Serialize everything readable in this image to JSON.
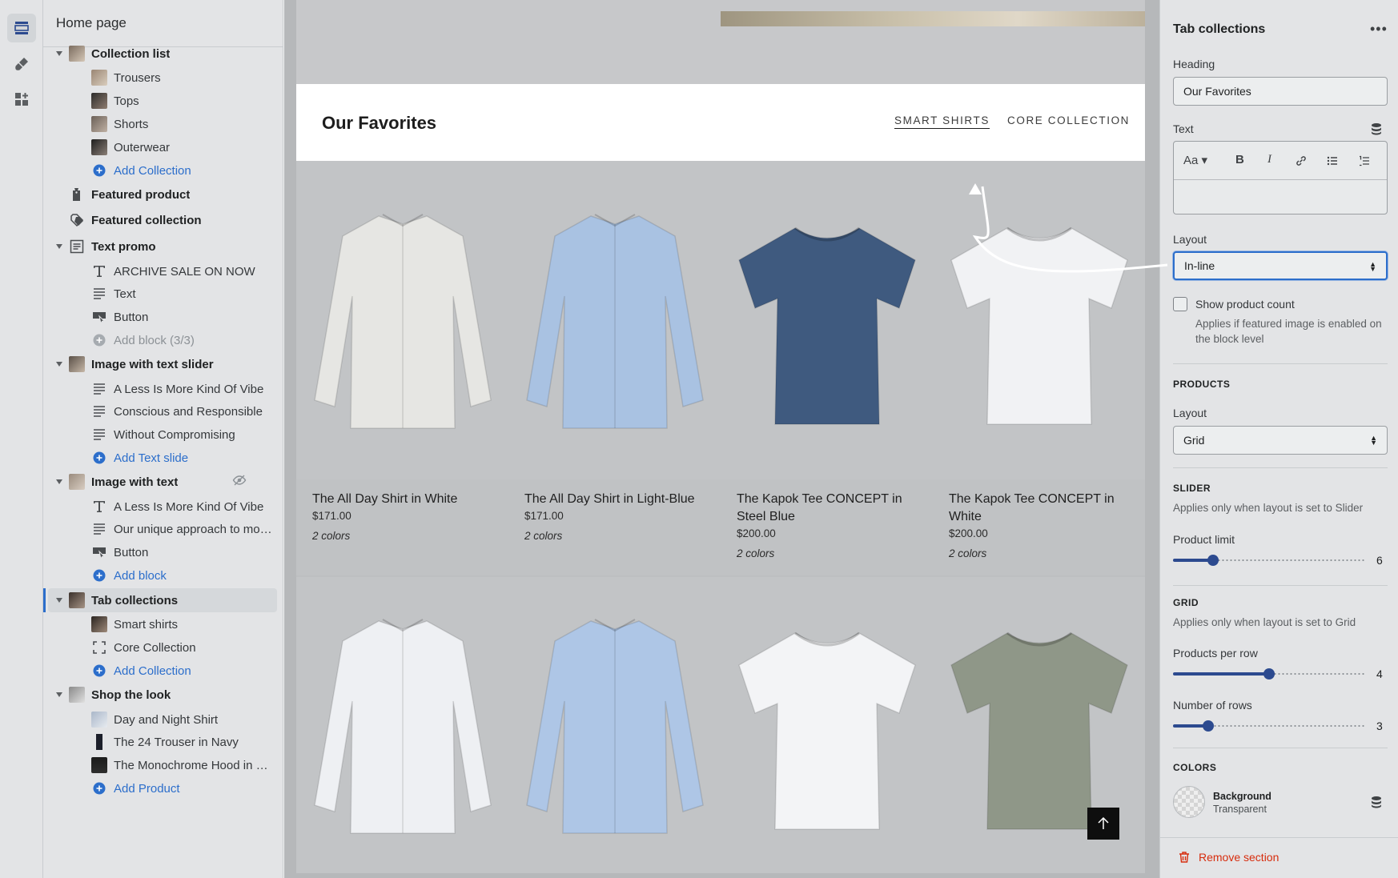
{
  "sidebar": {
    "title": "Home page",
    "rows": [
      {
        "type": "sec",
        "label": "Collection list",
        "caret": true,
        "thumb": "collection"
      },
      {
        "type": "child",
        "label": "Trousers",
        "thumb": "trousers"
      },
      {
        "type": "child",
        "label": "Tops",
        "thumb": "tops"
      },
      {
        "type": "child",
        "label": "Shorts",
        "thumb": "shorts"
      },
      {
        "type": "child",
        "label": "Outerwear",
        "thumb": "outerwear"
      },
      {
        "type": "child add",
        "label": "Add Collection",
        "icon": "plus-circle-icon"
      },
      {
        "type": "sec",
        "label": "Featured product",
        "icon": "product-tag-icon"
      },
      {
        "type": "sec",
        "label": "Featured collection",
        "icon": "collection-tag-icon"
      },
      {
        "type": "sec",
        "label": "Text promo",
        "caret": true,
        "icon": "text-block-icon"
      },
      {
        "type": "child",
        "label": "ARCHIVE SALE ON NOW",
        "icon": "heading-icon"
      },
      {
        "type": "child",
        "label": "Text",
        "icon": "paragraph-icon"
      },
      {
        "type": "child",
        "label": "Button",
        "icon": "button-icon"
      },
      {
        "type": "child disabled",
        "label": "Add block (3/3)",
        "icon": "plus-circle-disabled-icon"
      },
      {
        "type": "sec",
        "label": "Image with text slider",
        "caret": true,
        "thumb": "slider"
      },
      {
        "type": "child",
        "label": "A Less Is More Kind Of Vibe",
        "icon": "paragraph-icon"
      },
      {
        "type": "child",
        "label": "Conscious and Responsible",
        "icon": "paragraph-icon"
      },
      {
        "type": "child",
        "label": "Without Compromising",
        "icon": "paragraph-icon"
      },
      {
        "type": "child add",
        "label": "Add Text slide",
        "icon": "plus-circle-icon"
      },
      {
        "type": "sec",
        "label": "Image with text",
        "caret": true,
        "thumb": "imgtext",
        "hidden": true
      },
      {
        "type": "child",
        "label": "A Less Is More Kind Of Vibe",
        "icon": "heading-icon"
      },
      {
        "type": "child",
        "label": "Our unique approach to mod...",
        "icon": "paragraph-icon"
      },
      {
        "type": "child",
        "label": "Button",
        "icon": "button-icon"
      },
      {
        "type": "child add",
        "label": "Add block",
        "icon": "plus-circle-icon"
      },
      {
        "type": "sec selected",
        "label": "Tab collections",
        "caret": true,
        "thumb": "tabs"
      },
      {
        "type": "child",
        "label": "Smart shirts",
        "thumb": "smart"
      },
      {
        "type": "child",
        "label": "Core Collection",
        "icon": "dashed-frame-icon"
      },
      {
        "type": "child add",
        "label": "Add Collection",
        "icon": "plus-circle-icon"
      },
      {
        "type": "sec",
        "label": "Shop the look",
        "caret": true,
        "thumb": "look"
      },
      {
        "type": "child",
        "label": "Day and Night Shirt",
        "thumb": "shirt"
      },
      {
        "type": "child",
        "label": "The 24 Trouser in Navy",
        "thumb": "trouser"
      },
      {
        "type": "child",
        "label": "The Monochrome Hood in Na...",
        "thumb": "hood"
      },
      {
        "type": "child add",
        "label": "Add Product",
        "icon": "plus-circle-icon"
      }
    ]
  },
  "preview": {
    "heading": "Our Favorites",
    "tabs": [
      {
        "label": "SMART SHIRTS",
        "active": true
      },
      {
        "label": "CORE COLLECTION",
        "active": false
      }
    ],
    "products": [
      {
        "name": "The All Day Shirt in White",
        "price": "$171.00",
        "colors": "2 colors",
        "kind": "shirt",
        "color": "#e6e6e3"
      },
      {
        "name": "The All Day Shirt in Light-Blue",
        "price": "$171.00",
        "colors": "2 colors",
        "kind": "shirt",
        "color": "#a9c2e2"
      },
      {
        "name": "The Kapok Tee CONCEPT in Steel Blue",
        "price": "$200.00",
        "colors": "2 colors",
        "kind": "tee",
        "color": "#3f5a7f"
      },
      {
        "name": "The Kapok Tee CONCEPT in White",
        "price": "$200.00",
        "colors": "2 colors",
        "kind": "tee",
        "color": "#f1f2f4"
      }
    ],
    "products_row2": [
      {
        "kind": "shirt",
        "color": "#eef0f3"
      },
      {
        "kind": "shirt",
        "color": "#aec6e6"
      },
      {
        "kind": "tee",
        "color": "#f3f4f6"
      },
      {
        "kind": "tee",
        "color": "#8f9788"
      }
    ]
  },
  "settings": {
    "title": "Tab collections",
    "heading_label": "Heading",
    "heading_value": "Our Favorites",
    "text_label": "Text",
    "layout_label": "Layout",
    "layout_value": "In-line",
    "show_count_label": "Show product count",
    "show_count_help": "Applies if featured image is enabled on the block level",
    "products_heading": "PRODUCTS",
    "products_layout_label": "Layout",
    "products_layout_value": "Grid",
    "slider_heading": "SLIDER",
    "slider_help": "Applies only when layout is set to Slider",
    "product_limit_label": "Product limit",
    "product_limit": 6,
    "grid_heading": "GRID",
    "grid_help": "Applies only when layout is set to Grid",
    "per_row_label": "Products per row",
    "per_row": 4,
    "rows_label": "Number of rows",
    "rows": 3,
    "colors_heading": "COLORS",
    "background_label": "Background",
    "background_value": "Transparent",
    "remove_label": "Remove section"
  }
}
